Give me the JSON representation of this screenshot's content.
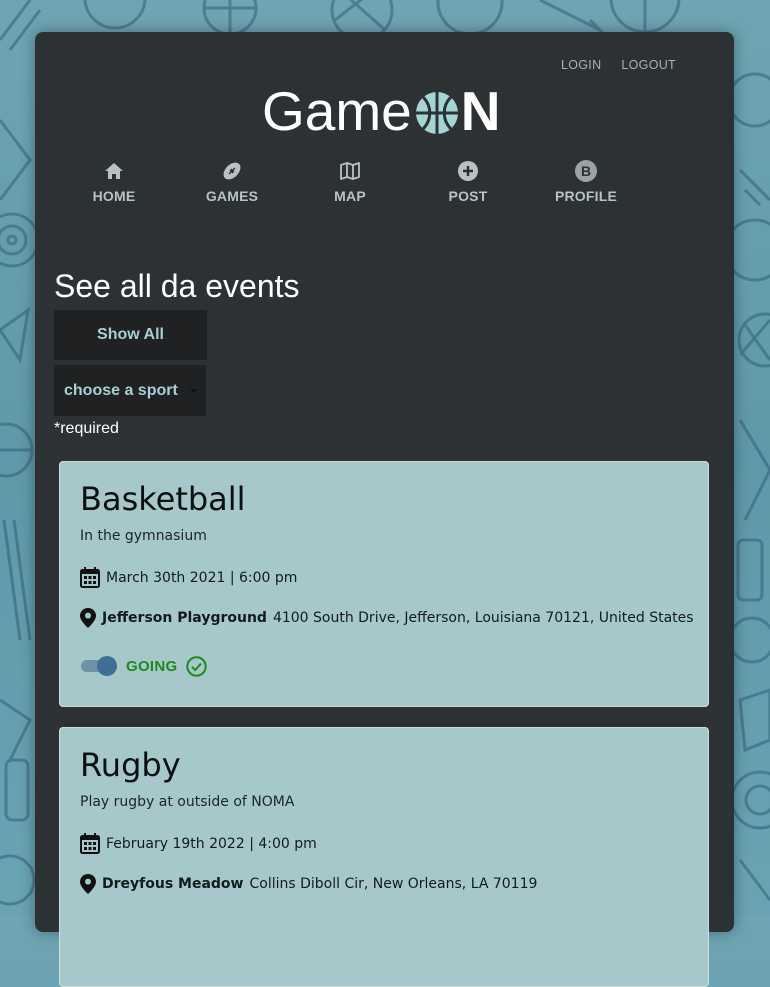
{
  "header": {
    "login_label": "LOGIN",
    "logout_label": "LOGOUT",
    "logo_text_left": "Game",
    "logo_text_right": "N"
  },
  "nav": {
    "items": [
      {
        "label": "HOME",
        "icon": "home-icon"
      },
      {
        "label": "GAMES",
        "icon": "football-icon"
      },
      {
        "label": "MAP",
        "icon": "map-icon"
      },
      {
        "label": "POST",
        "icon": "plus-circle-icon"
      },
      {
        "label": "PROFILE",
        "icon": "avatar",
        "avatar_letter": "B"
      }
    ]
  },
  "filters": {
    "page_title": "See all da events",
    "show_all_label": "Show All",
    "sport_select_value": "choose a sport",
    "required_note": "*required"
  },
  "events": [
    {
      "title": "Basketball",
      "description": "In the gymnasium",
      "datetime": "March 30th 2021 | 6:00 pm",
      "venue": "Jefferson Playground",
      "address": "4100 South Drive, Jefferson, Louisiana 70121, United States",
      "going_label": "GOING",
      "going": true
    },
    {
      "title": "Rugby",
      "description": "Play rugby at outside of NOMA",
      "datetime": "February 19th 2022 | 4:00 pm",
      "venue": "Dreyfous Meadow",
      "address": "Collins Diboll Cir, New Orleans, LA 70119"
    }
  ],
  "colors": {
    "panel_bg": "#2c3233",
    "card_bg": "#a6c8cb",
    "accent_teal": "#a8d0d4",
    "going_green": "#1e8a1e",
    "toggle_blue": "#3f6f95",
    "page_bg": "#6aa3b3"
  }
}
